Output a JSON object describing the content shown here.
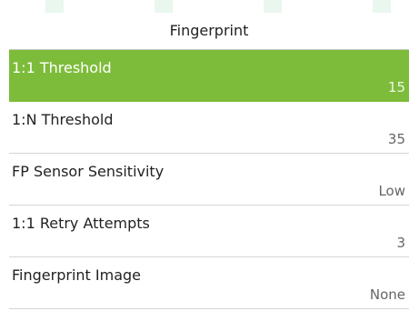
{
  "screen": {
    "title": "Fingerprint",
    "accent_color": "#7dbc3a",
    "selected_index": 0,
    "items": [
      {
        "label": "1:1 Threshold",
        "value": "15"
      },
      {
        "label": "1:N Threshold",
        "value": "35"
      },
      {
        "label": "FP Sensor Sensitivity",
        "value": "Low"
      },
      {
        "label": "1:1 Retry Attempts",
        "value": "3"
      },
      {
        "label": "Fingerprint Image",
        "value": "None"
      }
    ]
  }
}
